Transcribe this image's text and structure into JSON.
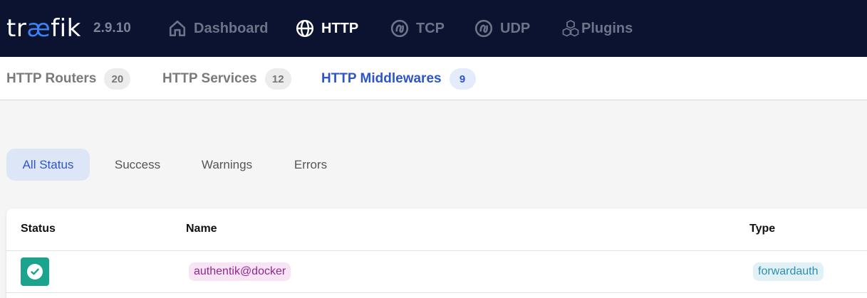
{
  "brand": {
    "logo_prefix": "tr",
    "logo_ae": "æ",
    "logo_suffix": "fik",
    "version": "2.9.10"
  },
  "nav": [
    {
      "label": "Dashboard",
      "icon": "home-icon",
      "active": false
    },
    {
      "label": "HTTP",
      "icon": "globe-icon",
      "active": true
    },
    {
      "label": "TCP",
      "icon": "tcp-icon",
      "active": false
    },
    {
      "label": "UDP",
      "icon": "udp-icon",
      "active": false
    },
    {
      "label": "Plugins",
      "icon": "cubes-icon",
      "active": false
    }
  ],
  "subnav": [
    {
      "label": "HTTP Routers",
      "count": "20",
      "active": false
    },
    {
      "label": "HTTP Services",
      "count": "12",
      "active": false
    },
    {
      "label": "HTTP Middlewares",
      "count": "9",
      "active": true
    }
  ],
  "filters": [
    {
      "label": "All Status",
      "active": true
    },
    {
      "label": "Success",
      "active": false
    },
    {
      "label": "Warnings",
      "active": false
    },
    {
      "label": "Errors",
      "active": false
    }
  ],
  "table": {
    "headers": {
      "status": "Status",
      "name": "Name",
      "type": "Type"
    },
    "rows": [
      {
        "status": "success",
        "status_icon": "check-icon",
        "name": "authentik@docker",
        "type": "forwardauth"
      }
    ]
  },
  "colors": {
    "nav_bg": "#0b1330",
    "accent": "#2f56c8",
    "success": "#1ba38d",
    "name_chip_bg": "#f8e4f4",
    "name_chip_text": "#8e2a8c",
    "type_chip_bg": "#e2f1f6",
    "type_chip_text": "#2a8fb3"
  }
}
